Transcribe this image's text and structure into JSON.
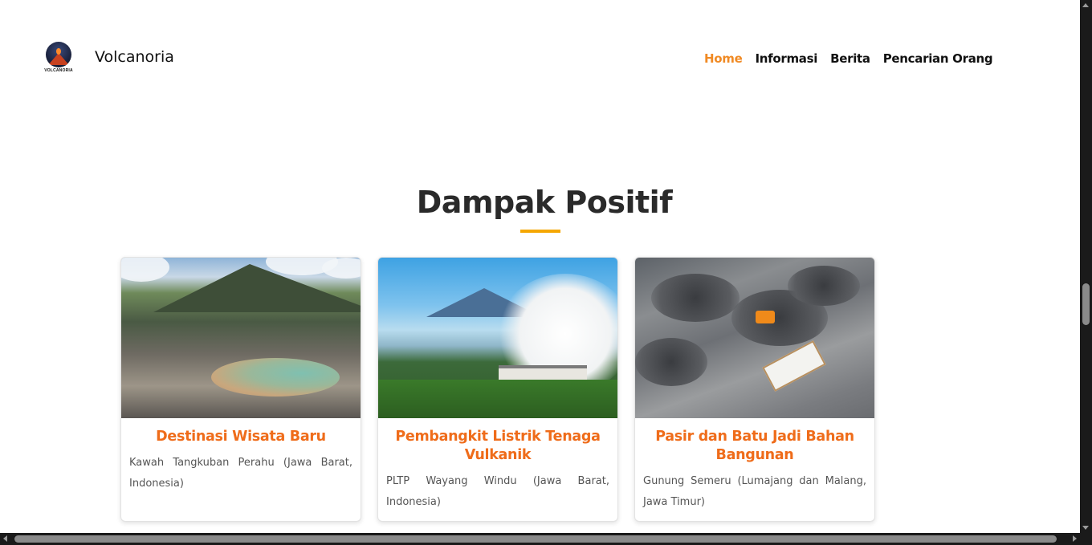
{
  "header": {
    "logo_text": "VOLCANORIA",
    "brand": "Volcanoria",
    "nav": [
      {
        "label": "Home",
        "active": true
      },
      {
        "label": "Informasi",
        "active": false
      },
      {
        "label": "Berita",
        "active": false
      },
      {
        "label": "Pencarian Orang",
        "active": false
      }
    ]
  },
  "section": {
    "title": "Dampak Positif",
    "accent_color": "#f5a700"
  },
  "cards": [
    {
      "title": "Destinasi Wisata Baru",
      "text": "Kawah Tangkuban Perahu (Jawa Barat, Indonesia)",
      "image_icon": "crater-photo"
    },
    {
      "title": "Pembangkit Listrik Tenaga Vulkanik",
      "text": "PLTP Wayang Windu (Jawa Barat, Indonesia)",
      "image_icon": "geothermal-plant-photo"
    },
    {
      "title": "Pasir dan Batu Jadi Bahan Bangunan",
      "text": "Gunung Semeru (Lumajang dan Malang, Jawa Timur)",
      "image_icon": "sand-quarry-photo"
    }
  ],
  "colors": {
    "nav_active": "#f08a24",
    "card_title": "#ef6c1a"
  }
}
